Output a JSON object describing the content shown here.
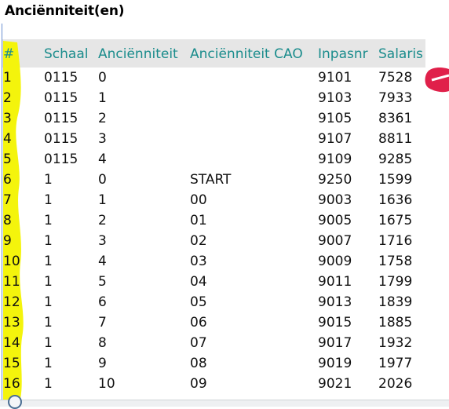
{
  "title": "Anciënniteit(en)",
  "columns": [
    "#",
    "Schaal",
    "Anciënniteit",
    "Anciënniteit CAO",
    "Inpasnr",
    "Salaris"
  ],
  "rows": [
    [
      "1",
      "0115",
      "0",
      "",
      "9101",
      "7528"
    ],
    [
      "2",
      "0115",
      "1",
      "",
      "9103",
      "7933"
    ],
    [
      "3",
      "0115",
      "2",
      "",
      "9105",
      "8361"
    ],
    [
      "4",
      "0115",
      "3",
      "",
      "9107",
      "8811"
    ],
    [
      "5",
      "0115",
      "4",
      "",
      "9109",
      "9285"
    ],
    [
      "6",
      "1",
      "0",
      "START",
      "9250",
      "1599"
    ],
    [
      "7",
      "1",
      "1",
      "00",
      "9003",
      "1636"
    ],
    [
      "8",
      "1",
      "2",
      "01",
      "9005",
      "1675"
    ],
    [
      "9",
      "1",
      "3",
      "02",
      "9007",
      "1716"
    ],
    [
      "10",
      "1",
      "4",
      "03",
      "9009",
      "1758"
    ],
    [
      "11",
      "1",
      "5",
      "04",
      "9011",
      "1799"
    ],
    [
      "12",
      "1",
      "6",
      "05",
      "9013",
      "1839"
    ],
    [
      "13",
      "1",
      "7",
      "06",
      "9015",
      "1885"
    ],
    [
      "14",
      "1",
      "8",
      "07",
      "9017",
      "1932"
    ],
    [
      "15",
      "1",
      "9",
      "08",
      "9019",
      "1977"
    ],
    [
      "16",
      "1",
      "10",
      "09",
      "9021",
      "2026"
    ]
  ],
  "colors": {
    "header_text": "#1a8c8c",
    "header_background": "#e6e6e6",
    "highlight": "#f4f40c",
    "annotation_mark": "#e0204a"
  }
}
